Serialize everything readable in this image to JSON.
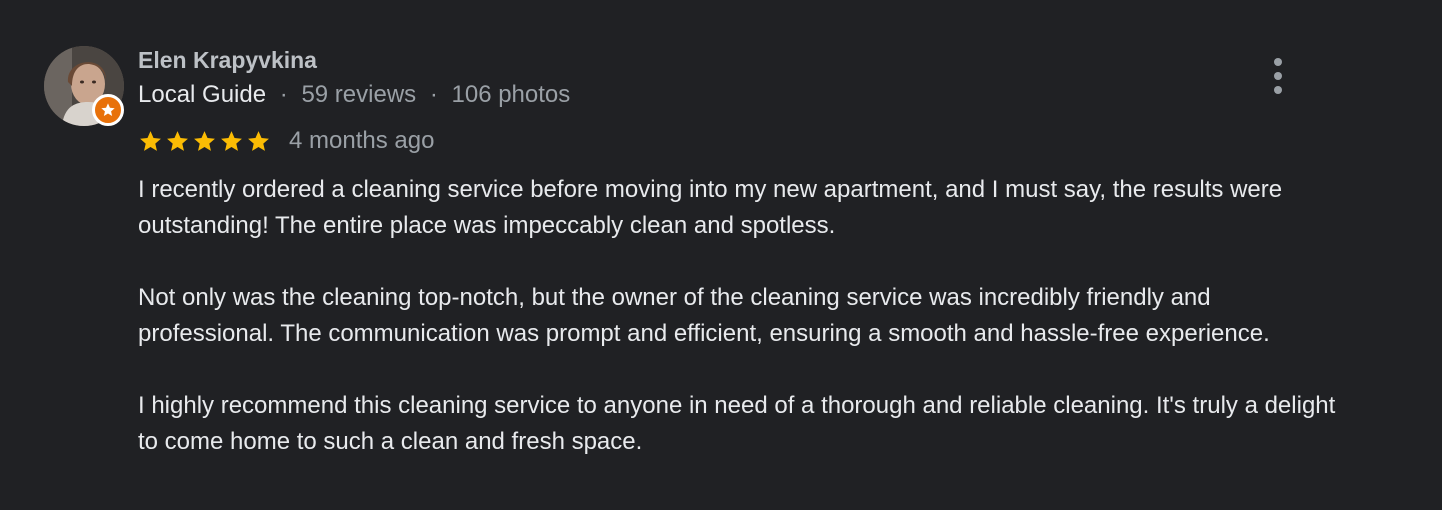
{
  "review": {
    "author": {
      "name": "Elen Krapyvkina",
      "avatar_icon": "user-photo",
      "badge_icon": "local-guide-star-icon",
      "badge_color": "#e8710a"
    },
    "meta": {
      "level": "Local Guide",
      "separator": "·",
      "reviews": "59 reviews",
      "photos": "106 photos"
    },
    "rating": {
      "stars": 5,
      "max": 5,
      "star_color": "#fbbc04"
    },
    "time": "4 months ago",
    "more_icon": "more-vert-icon",
    "paragraphs": [
      "I recently ordered a cleaning service before moving into my new apartment, and I must say, the results were outstanding! The entire place was impeccably clean and spotless.",
      "Not only was the cleaning top-notch, but the owner of the cleaning service was incredibly friendly and professional. The communication was prompt and efficient, ensuring a smooth and hassle-free experience.",
      "I highly recommend this cleaning service to anyone in need of a thorough and reliable cleaning. It's truly a delight to come home to such a clean and fresh space."
    ]
  }
}
